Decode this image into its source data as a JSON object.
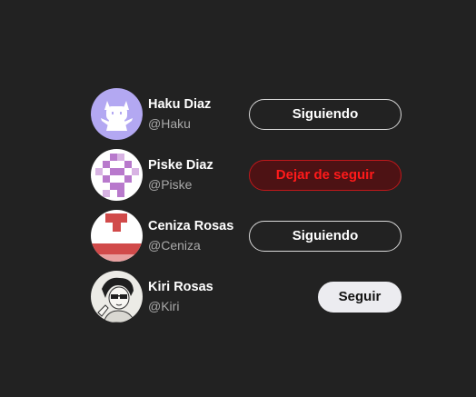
{
  "users": [
    {
      "name": "Haku Diaz",
      "handle": "@Haku",
      "button_label": "Siguiendo",
      "button_state": "following"
    },
    {
      "name": "Piske Diaz",
      "handle": "@Piske",
      "button_label": "Dejar de seguir",
      "button_state": "unfollow-hover"
    },
    {
      "name": "Ceniza Rosas",
      "handle": "@Ceniza",
      "button_label": "Siguiendo",
      "button_state": "following"
    },
    {
      "name": "Kiri Rosas",
      "handle": "@Kiri",
      "button_label": "Seguir",
      "button_state": "not-following"
    }
  ],
  "colors": {
    "background": "#222222",
    "following_border": "#d9d9d9",
    "unfollow_bg": "#4d1214",
    "unfollow_text": "#ff1a1a",
    "follow_bg": "#ececf0"
  },
  "avatars": [
    "cat-mascot-avatar",
    "pixel-pattern-avatar",
    "red-shape-avatar",
    "sketch-portrait-avatar"
  ]
}
